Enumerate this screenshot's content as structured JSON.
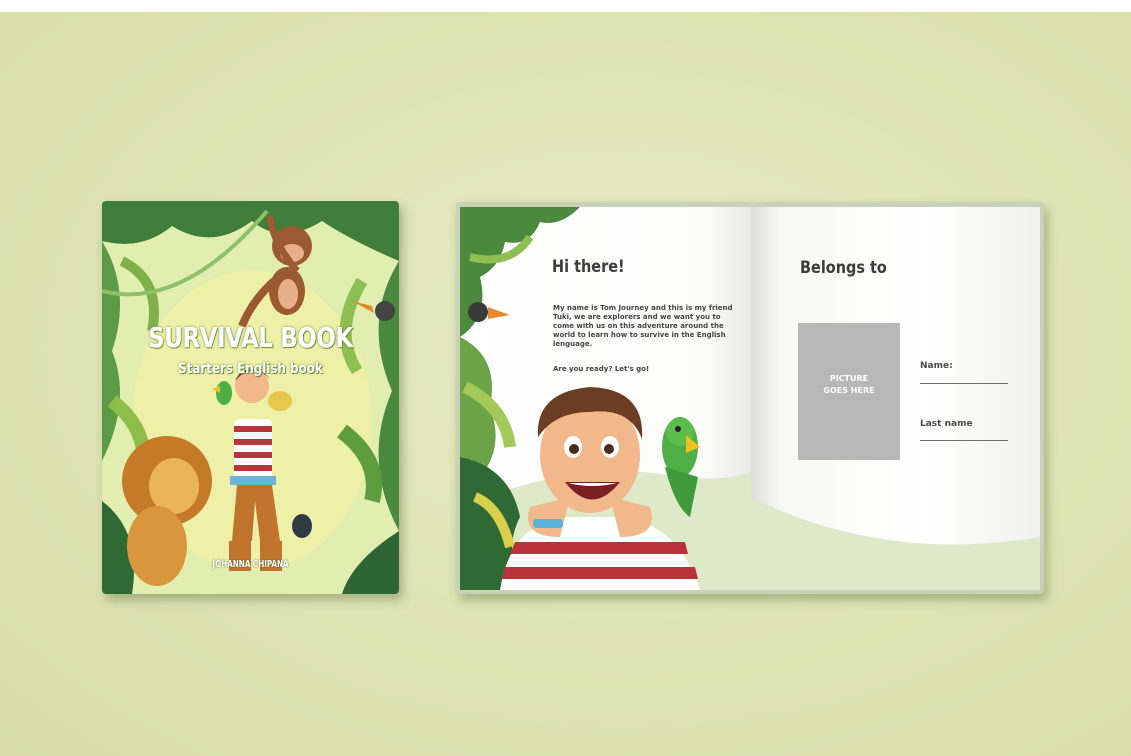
{
  "cover": {
    "title": "SURVIVAL BOOK",
    "subtitle": "Starters English book",
    "author": "JOHANNA CHIPANA"
  },
  "left_page": {
    "heading": "Hi there!",
    "paragraph": "My name is Tom Journey and this is my friend Tuki, we are explorers and we want you to come with us on this adventure around the world to learn how to survive in the English lenguage.",
    "cta": "Are you ready? Let's go!"
  },
  "right_page": {
    "heading": "Belongs to",
    "picture_placeholder": "PICTURE\nGOES HERE",
    "name_label": "Name:",
    "last_name_label": "Last name"
  },
  "colors": {
    "background": "#dde4b3",
    "jungle_green": "#4f8a3c",
    "placeholder_gray": "#b7b7b7"
  }
}
